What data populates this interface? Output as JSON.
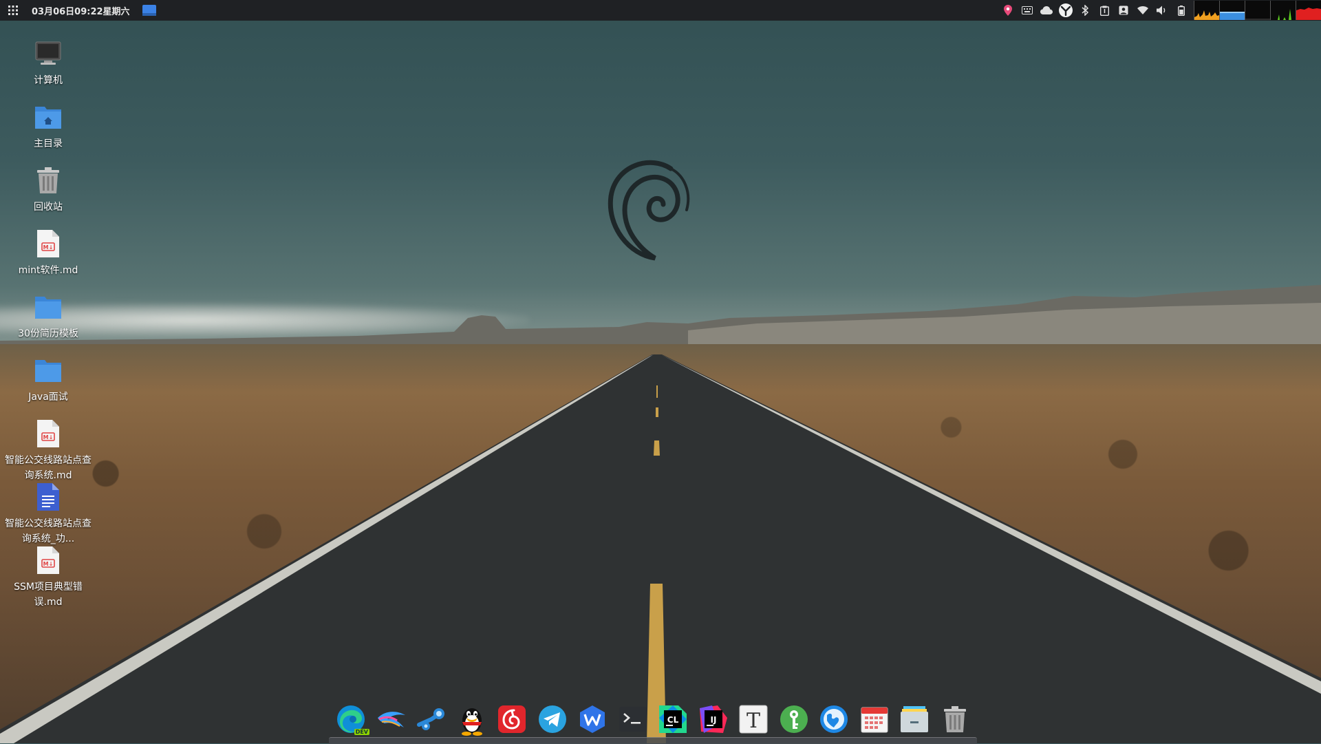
{
  "top_panel": {
    "clock": "03月06日09:22星期六",
    "launcher_icon": "grid-icon",
    "workspace_icon": "workspace-icon",
    "tray_icons": [
      "map-pin-icon",
      "keyboard-icon",
      "cloud-icon",
      "yingwu-icon",
      "bluetooth-icon",
      "clipboard-icon",
      "account-icon",
      "wifi-icon",
      "volume-icon",
      "battery-icon"
    ]
  },
  "desktop": {
    "items": [
      {
        "label": "计算机",
        "icon": "computer-icon"
      },
      {
        "label": "主目录",
        "icon": "home-folder-icon"
      },
      {
        "label": "回收站",
        "icon": "trash-icon"
      },
      {
        "label": "mint软件.md",
        "icon": "markdown-file-icon"
      },
      {
        "label": "30份简历模板",
        "icon": "folder-icon"
      },
      {
        "label": "Java面试",
        "icon": "folder-icon"
      },
      {
        "label": "智能公交线路站点查询系统.md",
        "icon": "markdown-file-icon"
      },
      {
        "label": "智能公交线路站点查询系统_功...",
        "icon": "document-icon"
      },
      {
        "label": "SSM项目典型错误.md",
        "icon": "markdown-file-icon"
      }
    ]
  },
  "dock": {
    "apps": [
      {
        "name": "edge-dev-icon",
        "badge": "DEV"
      },
      {
        "name": "kali-dragon-icon"
      },
      {
        "name": "steam-icon"
      },
      {
        "name": "qq-icon"
      },
      {
        "name": "netease-music-icon"
      },
      {
        "name": "telegram-icon"
      },
      {
        "name": "wps-icon"
      },
      {
        "name": "terminal-icon"
      },
      {
        "name": "clion-icon",
        "text": "CL"
      },
      {
        "name": "intellij-icon",
        "text": "IJ"
      },
      {
        "name": "typora-icon",
        "text": "T"
      },
      {
        "name": "keyring-icon"
      },
      {
        "name": "browser-globe-icon"
      },
      {
        "name": "calendar-icon"
      },
      {
        "name": "file-manager-icon"
      },
      {
        "name": "trash-icon"
      }
    ]
  },
  "colors": {
    "panel_bg": "#1f2124",
    "sky": "#3d5b5e",
    "accent_blue": "#3b82e6"
  }
}
